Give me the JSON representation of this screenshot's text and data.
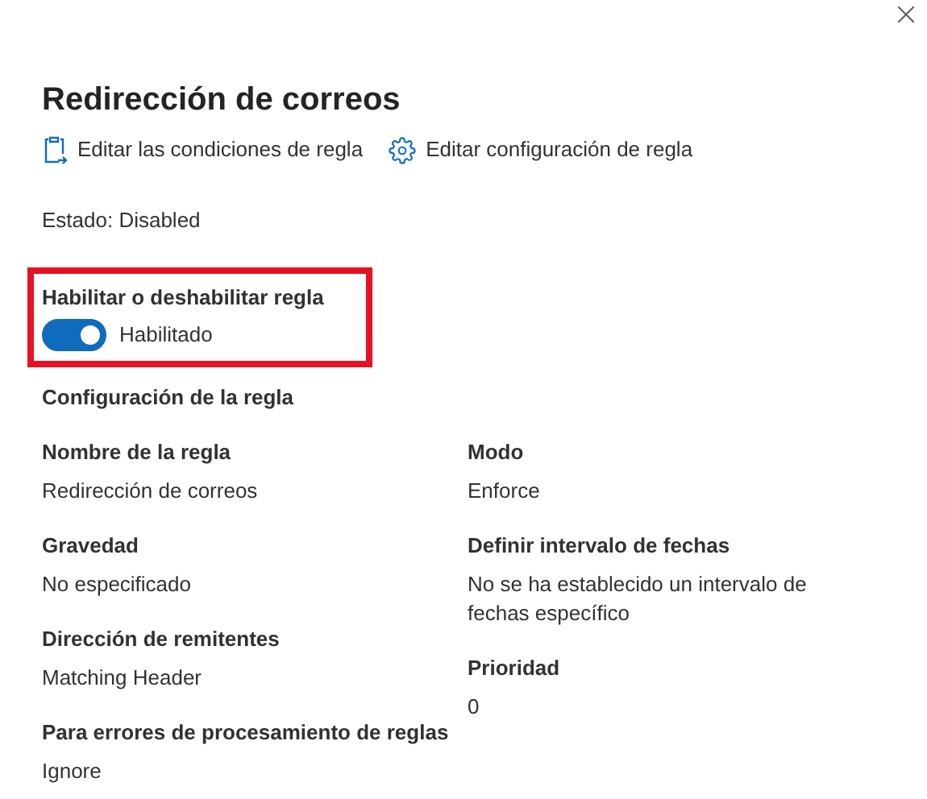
{
  "title": "Redirección de correos",
  "actions": [
    {
      "kind": "clipboard",
      "label": "Editar las condiciones de regla"
    },
    {
      "kind": "gear",
      "label": "Editar configuración de regla"
    }
  ],
  "status": "Estado: Disabled",
  "toggle_section": {
    "highlighted": true,
    "label": "Habilitar o deshabilitar regla",
    "on": true,
    "state_text": "Habilitado"
  },
  "config_heading": "Configuración de la regla",
  "columns": [
    [
      {
        "label": "Nombre de la regla",
        "value": "Redirección de correos"
      },
      {
        "label": "Gravedad",
        "value": "No especificado"
      },
      {
        "label": "Dirección de remitentes",
        "value": "Matching Header"
      },
      {
        "label": "Para errores de procesamiento de reglas",
        "value": "Ignore"
      }
    ],
    [
      {
        "label": "Modo",
        "value": "Enforce"
      },
      {
        "label": "Definir intervalo de fechas",
        "value": "No se ha establecido un intervalo de fechas específico"
      },
      {
        "label": "Prioridad",
        "value": "0"
      }
    ]
  ]
}
